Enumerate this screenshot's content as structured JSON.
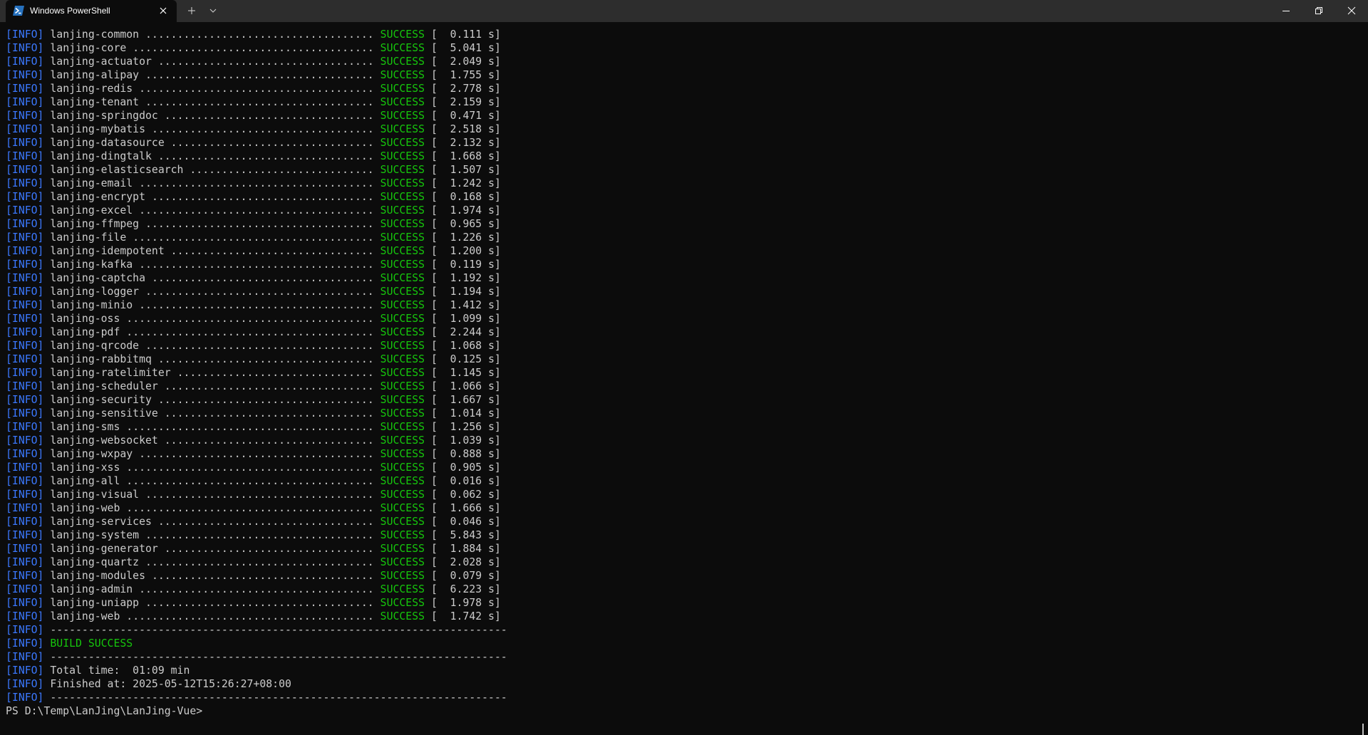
{
  "window": {
    "tab_title": "Windows PowerShell",
    "accent_info": "#3b78ff",
    "accent_success": "#16c60c",
    "text_color": "#cccccc",
    "background": "#0c0c0c"
  },
  "icons": {
    "tab": "powershell-icon",
    "tab_close": "close-icon",
    "new_tab": "plus-icon",
    "dropdown": "chevron-down-icon",
    "minimize": "minimize-icon",
    "maximize": "restore-icon",
    "close": "close-icon"
  },
  "terminal": {
    "modules": [
      {
        "info": "[INFO]",
        "name": "lanjing-common",
        "dots": "....................................",
        "status": "SUCCESS",
        "time": "[  0.111 s]"
      },
      {
        "info": "[INFO]",
        "name": "lanjing-core",
        "dots": "......................................",
        "status": "SUCCESS",
        "time": "[  5.041 s]"
      },
      {
        "info": "[INFO]",
        "name": "lanjing-actuator",
        "dots": "..................................",
        "status": "SUCCESS",
        "time": "[  2.049 s]"
      },
      {
        "info": "[INFO]",
        "name": "lanjing-alipay",
        "dots": "....................................",
        "status": "SUCCESS",
        "time": "[  1.755 s]"
      },
      {
        "info": "[INFO]",
        "name": "lanjing-redis",
        "dots": ".....................................",
        "status": "SUCCESS",
        "time": "[  2.778 s]"
      },
      {
        "info": "[INFO]",
        "name": "lanjing-tenant",
        "dots": "....................................",
        "status": "SUCCESS",
        "time": "[  2.159 s]"
      },
      {
        "info": "[INFO]",
        "name": "lanjing-springdoc",
        "dots": ".................................",
        "status": "SUCCESS",
        "time": "[  0.471 s]"
      },
      {
        "info": "[INFO]",
        "name": "lanjing-mybatis",
        "dots": "...................................",
        "status": "SUCCESS",
        "time": "[  2.518 s]"
      },
      {
        "info": "[INFO]",
        "name": "lanjing-datasource",
        "dots": "................................",
        "status": "SUCCESS",
        "time": "[  2.132 s]"
      },
      {
        "info": "[INFO]",
        "name": "lanjing-dingtalk",
        "dots": "..................................",
        "status": "SUCCESS",
        "time": "[  1.668 s]"
      },
      {
        "info": "[INFO]",
        "name": "lanjing-elasticsearch",
        "dots": ".............................",
        "status": "SUCCESS",
        "time": "[  1.507 s]"
      },
      {
        "info": "[INFO]",
        "name": "lanjing-email",
        "dots": ".....................................",
        "status": "SUCCESS",
        "time": "[  1.242 s]"
      },
      {
        "info": "[INFO]",
        "name": "lanjing-encrypt",
        "dots": "...................................",
        "status": "SUCCESS",
        "time": "[  0.168 s]"
      },
      {
        "info": "[INFO]",
        "name": "lanjing-excel",
        "dots": ".....................................",
        "status": "SUCCESS",
        "time": "[  1.974 s]"
      },
      {
        "info": "[INFO]",
        "name": "lanjing-ffmpeg",
        "dots": "....................................",
        "status": "SUCCESS",
        "time": "[  0.965 s]"
      },
      {
        "info": "[INFO]",
        "name": "lanjing-file",
        "dots": "......................................",
        "status": "SUCCESS",
        "time": "[  1.226 s]"
      },
      {
        "info": "[INFO]",
        "name": "lanjing-idempotent",
        "dots": "................................",
        "status": "SUCCESS",
        "time": "[  1.200 s]"
      },
      {
        "info": "[INFO]",
        "name": "lanjing-kafka",
        "dots": ".....................................",
        "status": "SUCCESS",
        "time": "[  0.119 s]"
      },
      {
        "info": "[INFO]",
        "name": "lanjing-captcha",
        "dots": "...................................",
        "status": "SUCCESS",
        "time": "[  1.192 s]"
      },
      {
        "info": "[INFO]",
        "name": "lanjing-logger",
        "dots": "....................................",
        "status": "SUCCESS",
        "time": "[  1.194 s]"
      },
      {
        "info": "[INFO]",
        "name": "lanjing-minio",
        "dots": ".....................................",
        "status": "SUCCESS",
        "time": "[  1.412 s]"
      },
      {
        "info": "[INFO]",
        "name": "lanjing-oss",
        "dots": ".......................................",
        "status": "SUCCESS",
        "time": "[  1.099 s]"
      },
      {
        "info": "[INFO]",
        "name": "lanjing-pdf",
        "dots": ".......................................",
        "status": "SUCCESS",
        "time": "[  2.244 s]"
      },
      {
        "info": "[INFO]",
        "name": "lanjing-qrcode",
        "dots": "....................................",
        "status": "SUCCESS",
        "time": "[  1.068 s]"
      },
      {
        "info": "[INFO]",
        "name": "lanjing-rabbitmq",
        "dots": "..................................",
        "status": "SUCCESS",
        "time": "[  0.125 s]"
      },
      {
        "info": "[INFO]",
        "name": "lanjing-ratelimiter",
        "dots": "...............................",
        "status": "SUCCESS",
        "time": "[  1.145 s]"
      },
      {
        "info": "[INFO]",
        "name": "lanjing-scheduler",
        "dots": ".................................",
        "status": "SUCCESS",
        "time": "[  1.066 s]"
      },
      {
        "info": "[INFO]",
        "name": "lanjing-security",
        "dots": "..................................",
        "status": "SUCCESS",
        "time": "[  1.667 s]"
      },
      {
        "info": "[INFO]",
        "name": "lanjing-sensitive",
        "dots": ".................................",
        "status": "SUCCESS",
        "time": "[  1.014 s]"
      },
      {
        "info": "[INFO]",
        "name": "lanjing-sms",
        "dots": ".......................................",
        "status": "SUCCESS",
        "time": "[  1.256 s]"
      },
      {
        "info": "[INFO]",
        "name": "lanjing-websocket",
        "dots": ".................................",
        "status": "SUCCESS",
        "time": "[  1.039 s]"
      },
      {
        "info": "[INFO]",
        "name": "lanjing-wxpay",
        "dots": ".....................................",
        "status": "SUCCESS",
        "time": "[  0.888 s]"
      },
      {
        "info": "[INFO]",
        "name": "lanjing-xss",
        "dots": ".......................................",
        "status": "SUCCESS",
        "time": "[  0.905 s]"
      },
      {
        "info": "[INFO]",
        "name": "lanjing-all",
        "dots": ".......................................",
        "status": "SUCCESS",
        "time": "[  0.016 s]"
      },
      {
        "info": "[INFO]",
        "name": "lanjing-visual",
        "dots": "....................................",
        "status": "SUCCESS",
        "time": "[  0.062 s]"
      },
      {
        "info": "[INFO]",
        "name": "lanjing-web",
        "dots": ".......................................",
        "status": "SUCCESS",
        "time": "[  1.666 s]"
      },
      {
        "info": "[INFO]",
        "name": "lanjing-services",
        "dots": "..................................",
        "status": "SUCCESS",
        "time": "[  0.046 s]"
      },
      {
        "info": "[INFO]",
        "name": "lanjing-system",
        "dots": "....................................",
        "status": "SUCCESS",
        "time": "[  5.843 s]"
      },
      {
        "info": "[INFO]",
        "name": "lanjing-generator",
        "dots": ".................................",
        "status": "SUCCESS",
        "time": "[  1.884 s]"
      },
      {
        "info": "[INFO]",
        "name": "lanjing-quartz",
        "dots": "....................................",
        "status": "SUCCESS",
        "time": "[  2.028 s]"
      },
      {
        "info": "[INFO]",
        "name": "lanjing-modules",
        "dots": "...................................",
        "status": "SUCCESS",
        "time": "[  0.079 s]"
      },
      {
        "info": "[INFO]",
        "name": "lanjing-admin",
        "dots": ".....................................",
        "status": "SUCCESS",
        "time": "[  6.223 s]"
      },
      {
        "info": "[INFO]",
        "name": "lanjing-uniapp",
        "dots": "....................................",
        "status": "SUCCESS",
        "time": "[  1.978 s]"
      },
      {
        "info": "[INFO]",
        "name": "lanjing-web",
        "dots": ".......................................",
        "status": "SUCCESS",
        "time": "[  1.742 s]"
      }
    ],
    "separator1": {
      "info": "[INFO]",
      "text": "------------------------------------------------------------------------"
    },
    "build_result": {
      "info": "[INFO]",
      "text": "BUILD SUCCESS"
    },
    "separator2": {
      "info": "[INFO]",
      "text": "------------------------------------------------------------------------"
    },
    "total_time": {
      "info": "[INFO]",
      "text": "Total time:  01:09 min"
    },
    "finished_at": {
      "info": "[INFO]",
      "text": "Finished at: 2025-05-12T15:26:27+08:00"
    },
    "separator3": {
      "info": "[INFO]",
      "text": "------------------------------------------------------------------------"
    },
    "prompt": "PS D:\\Temp\\LanJing\\LanJing-Vue>"
  }
}
